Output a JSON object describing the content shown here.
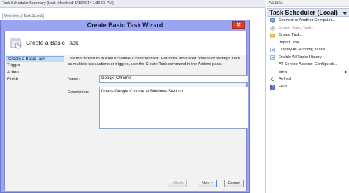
{
  "background": {
    "title": "Task Scheduler Summary (Last refreshed: 1/11/2014 1:36:03 PM)",
    "tab_label": "Overview of Task Scheduler"
  },
  "actions_pane": {
    "header": "Actions",
    "section_title": "Task Scheduler (Local)",
    "items": [
      {
        "label": "Connect to Another Computer...",
        "icon": "computer-icon",
        "disabled": false
      },
      {
        "label": "Create Basic Task...",
        "icon": "clock-icon",
        "disabled": true
      },
      {
        "label": "Create Task...",
        "icon": "folder-icon",
        "disabled": false
      },
      {
        "label": "Import Task...",
        "icon": "",
        "disabled": false
      },
      {
        "label": "Display All Running Tasks",
        "icon": "list-icon",
        "disabled": false
      },
      {
        "label": "Enable All Tasks History",
        "icon": "history-icon",
        "disabled": false
      },
      {
        "label": "AT Service Account Configurati...",
        "icon": "",
        "disabled": false
      },
      {
        "label": "View",
        "icon": "",
        "disabled": false
      },
      {
        "label": "Refresh",
        "icon": "refresh-icon",
        "disabled": false
      },
      {
        "label": "Help",
        "icon": "help-icon",
        "disabled": false
      }
    ]
  },
  "dialog": {
    "title": "Create Basic Task Wizard",
    "close_glyph": "✕",
    "heading": "Create a Basic Task",
    "steps": [
      "Create a Basic Task",
      "Trigger",
      "Action",
      "Finish"
    ],
    "intro": "Use this wizard to quickly schedule a common task.  For more advanced options or settings such as multiple task actions or triggers, use the Create Task command in the Actions pane.",
    "name_label": "Name:",
    "name_value": "Google Chrome",
    "description_label": "Description:",
    "description_value": "Opens Google Chrome at Windows Start up",
    "buttons": {
      "back": "< Back",
      "next": "Next >",
      "cancel": "Cancel"
    }
  },
  "colors": {
    "dialog_frame": "#9aa4f0",
    "close_button": "#d84032",
    "selected_step": "#c6daf4",
    "section_header": "#dfe7f3"
  }
}
